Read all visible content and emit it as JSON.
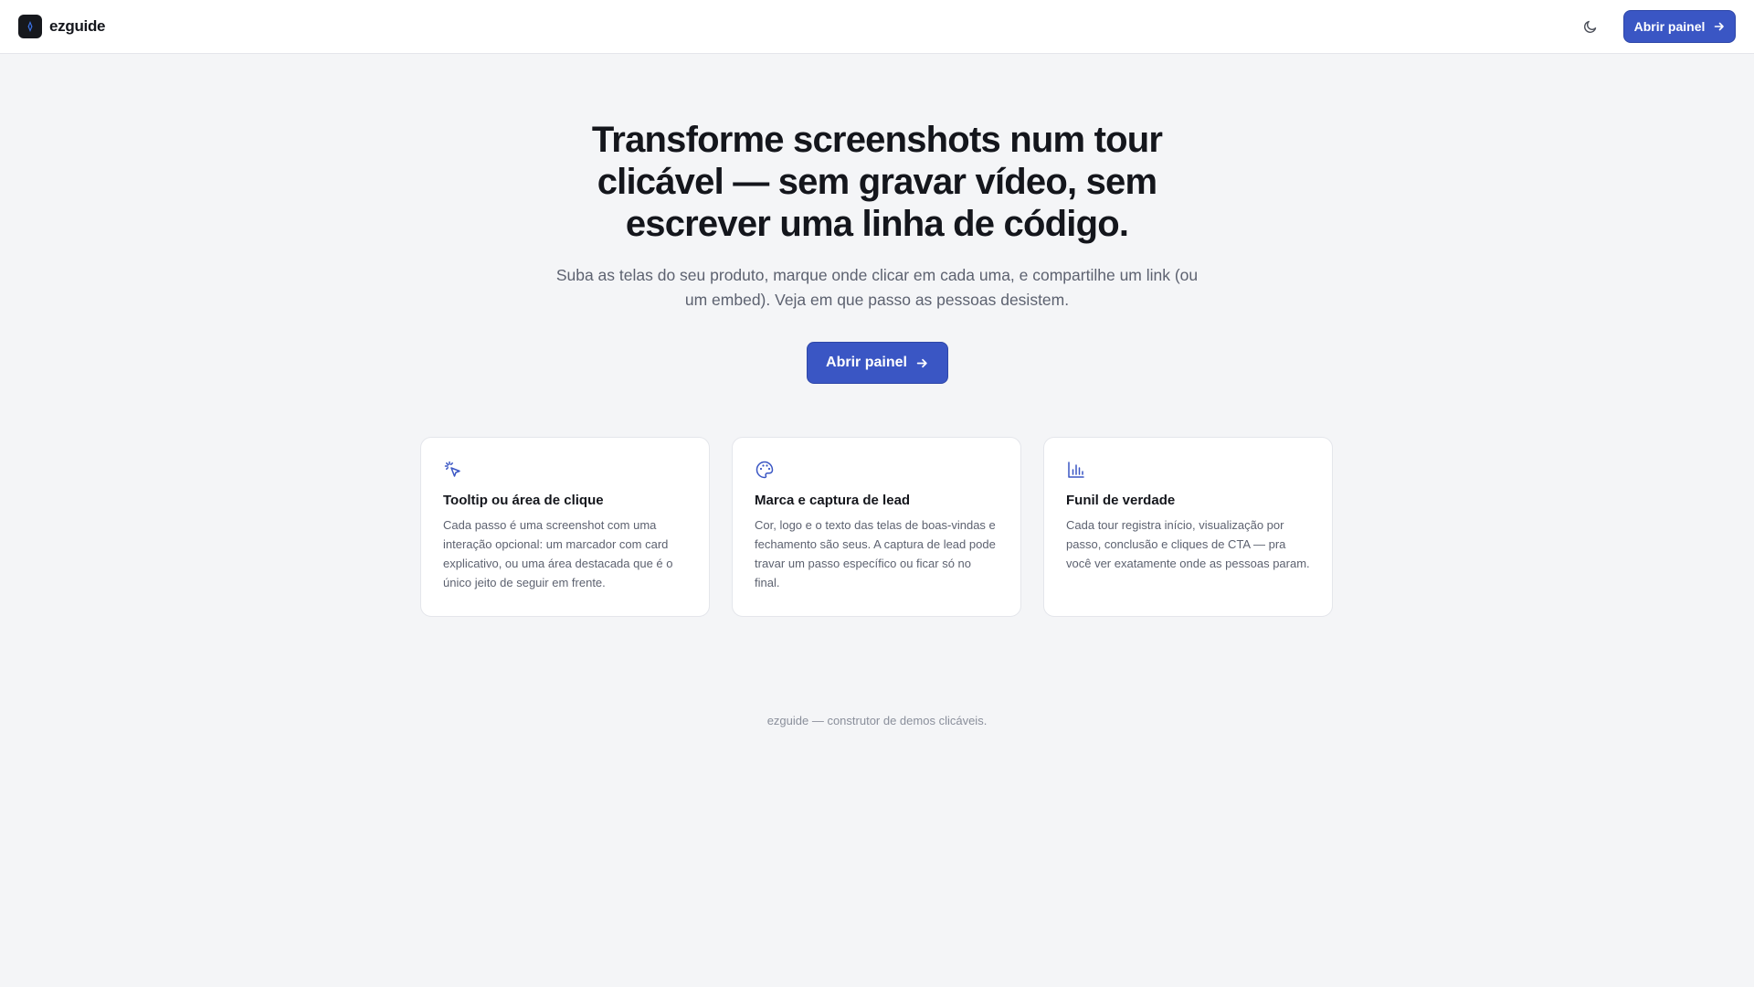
{
  "header": {
    "brand": "ezguide",
    "open_panel_label": "Abrir painel",
    "theme_icon": "moon-icon"
  },
  "hero": {
    "title": "Transforme screenshots num tour clicável — sem gravar vídeo, sem escrever uma linha de código.",
    "subtitle": "Suba as telas do seu produto, marque onde clicar em cada uma, e compartilhe um link (ou um embed). Veja em que passo as pessoas desistem.",
    "cta_label": "Abrir painel"
  },
  "features": [
    {
      "icon": "cursor-click-icon",
      "title": "Tooltip ou área de clique",
      "text": "Cada passo é uma screenshot com uma interação opcional: um marcador com card explicativo, ou uma área destacada que é o único jeito de seguir em frente."
    },
    {
      "icon": "palette-icon",
      "title": "Marca e captura de lead",
      "text": "Cor, logo e o texto das telas de boas-vindas e fechamento são seus. A captura de lead pode travar um passo específico ou ficar só no final."
    },
    {
      "icon": "bar-chart-icon",
      "title": "Funil de verdade",
      "text": "Cada tour registra início, visualização por passo, conclusão e cliques de CTA — pra você ver exatamente onde as pessoas param."
    }
  ],
  "footer": {
    "text": "ezguide — construtor de demos clicáveis."
  },
  "colors": {
    "accent": "#3a56c4",
    "background": "#f4f5f7",
    "surface": "#ffffff",
    "text": "#14161c",
    "muted": "#5d6270"
  }
}
